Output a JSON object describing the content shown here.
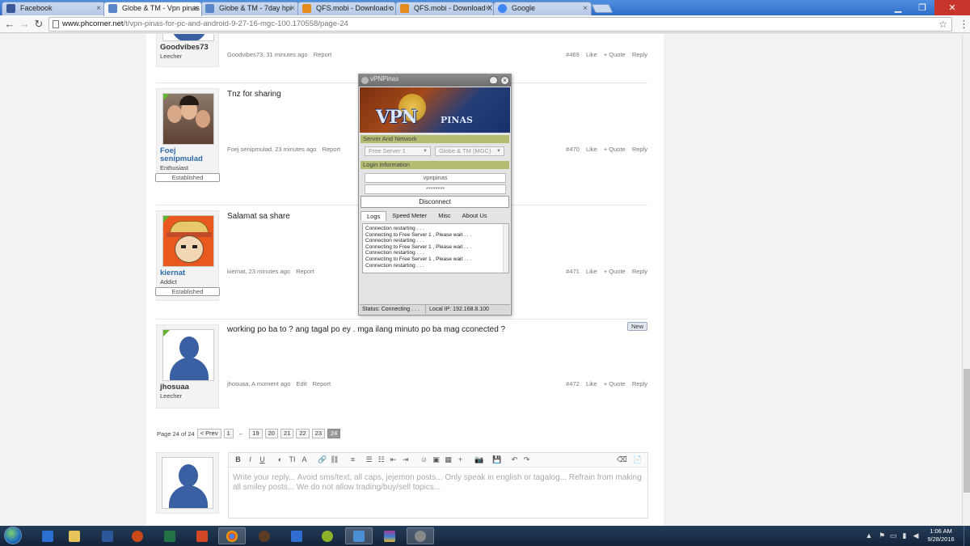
{
  "browser": {
    "tabs": [
      {
        "title": "Facebook",
        "color": "#3b5998"
      },
      {
        "title": "Globe & TM - Vpn pinas",
        "color": "#5a87c7"
      },
      {
        "title": "Globe & TM - 7day hpi",
        "color": "#5a87c7"
      },
      {
        "title": "QFS.mobi - Download o",
        "color": "#e58a1f"
      },
      {
        "title": "QFS.mobi - Download X",
        "color": "#e58a1f"
      },
      {
        "title": "Google",
        "color": "#4285f4"
      }
    ],
    "close_glyph": "×",
    "url_host": "www.phcorner.net",
    "url_path": "/t/vpn-pinas-for-pc-and-android-9-27-16-mgc-100.170558/page-24"
  },
  "posts": [
    {
      "user": "Goodvibes73",
      "title": "Leecher",
      "badge": "",
      "message": "",
      "author_time": "Goodvibes73, 31 minutes ago",
      "number": "#469"
    },
    {
      "user": "Foej senipmulad",
      "title": "Enthusiast",
      "badge": "Established",
      "message": "Tnz for sharing",
      "author_time": "Foej senipmulad, 23 minutes ago",
      "number": "#470"
    },
    {
      "user": "kiernat",
      "title": "Addict",
      "badge": "Established",
      "message": "Salamat sa share",
      "author_time": "kiernat, 23 minutes ago",
      "number": "#471"
    },
    {
      "user": "jhosuaa",
      "title": "Leecher",
      "badge": "",
      "message": "working po ba to ? ang tagal po ey . mga ilang minuto po ba mag cconected ?",
      "author_time": "jhosuaa, A moment ago",
      "number": "#472",
      "edit": "Edit",
      "new_badge": "New"
    }
  ],
  "post_actions": {
    "report": "Report",
    "like": "Like",
    "quote": "+ Quote",
    "reply": "Reply"
  },
  "pagination": {
    "label": "Page 24 of 24",
    "prev": "< Prev",
    "pages": [
      "1",
      "←",
      "19",
      "20",
      "21",
      "22",
      "23",
      "24"
    ],
    "current": "24"
  },
  "reply": {
    "placeholder": "Write your reply... Avoid sms/text, all caps, jejemon posts... Only speak in english or tagalog... Refrain from making all smiley posts... We do not allow trading/buy/sell topics...",
    "tools": [
      "B",
      "I",
      "U",
      "◐",
      "TI",
      "A",
      "🔗",
      "⛓",
      "≡",
      "☰",
      "☷",
      "⇤",
      "⇥",
      "☺",
      "▣",
      "▦",
      "+",
      "📷",
      "💾",
      "↶",
      "↷",
      "⌫",
      "📄"
    ]
  },
  "vpn": {
    "title": "vPNPinas",
    "logo_text": "VPN",
    "logo_sub": "PINAS",
    "server_section": "Server And Network",
    "server": "Free Server 1",
    "network": "Globe & TM (MGC)",
    "login_section": "Login Information",
    "username": "vpnpinas",
    "password": "********",
    "connect_button": "Disconnect",
    "tabs": [
      "Logs",
      "Speed Meter",
      "Misc",
      "About Us"
    ],
    "log_lines": [
      "Connection restarting . . .",
      "Connecting to Free Server 1 , Please wait . . .",
      "Connection restarting . . .",
      "Connecting to Free Server 1 , Please wait . . .",
      "Connection restarting . . .",
      "Connecting to Free Server 1 , Please wait . . .",
      "Connection restarting . . ."
    ],
    "status": "Status: Connecting . . .",
    "local_ip": "Local IP: 192.168.8.100"
  },
  "taskbar": {
    "time": "1:06 AM",
    "date": "9/28/2016"
  }
}
